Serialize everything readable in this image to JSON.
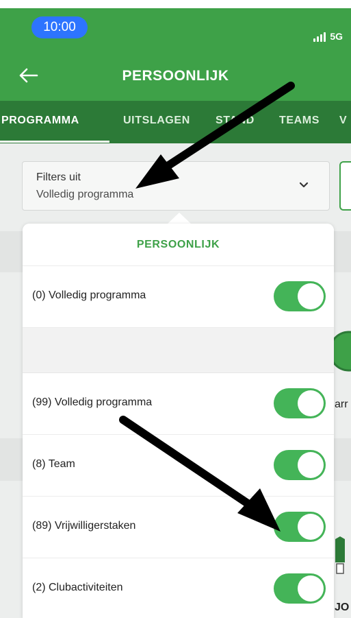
{
  "statusbar": {
    "time": "10:00",
    "network": "5G"
  },
  "header": {
    "title": "PERSOONLIJK",
    "back_icon": "arrow-left-icon"
  },
  "tabs": [
    {
      "label": "PROGRAMMA",
      "active": true
    },
    {
      "label": "UITSLAGEN",
      "active": false
    },
    {
      "label": "STAND",
      "active": false
    },
    {
      "label": "TEAMS",
      "active": false
    },
    {
      "label": "V",
      "active": false
    }
  ],
  "filter": {
    "line1": "Filters uit",
    "line2": "Volledig programma",
    "chevron_icon": "chevron-down-icon"
  },
  "background": {
    "edge_text_1": "arr",
    "edge_text_2": "JO"
  },
  "popover": {
    "title": "PERSOONLIJK",
    "rows": [
      {
        "label": "(0) Volledig programma",
        "enabled": true
      },
      {
        "label": "(99) Volledig programma",
        "enabled": true
      },
      {
        "label": "(8) Team",
        "enabled": true
      },
      {
        "label": "(89) Vrijwilligerstaken",
        "enabled": true
      },
      {
        "label": "(2) Clubactiviteiten",
        "enabled": true
      }
    ]
  },
  "colors": {
    "brand_green": "#3ea148",
    "tab_bar_green": "#2c7a37",
    "toggle_green": "#44b458",
    "time_pill_blue": "#2d74ff"
  }
}
